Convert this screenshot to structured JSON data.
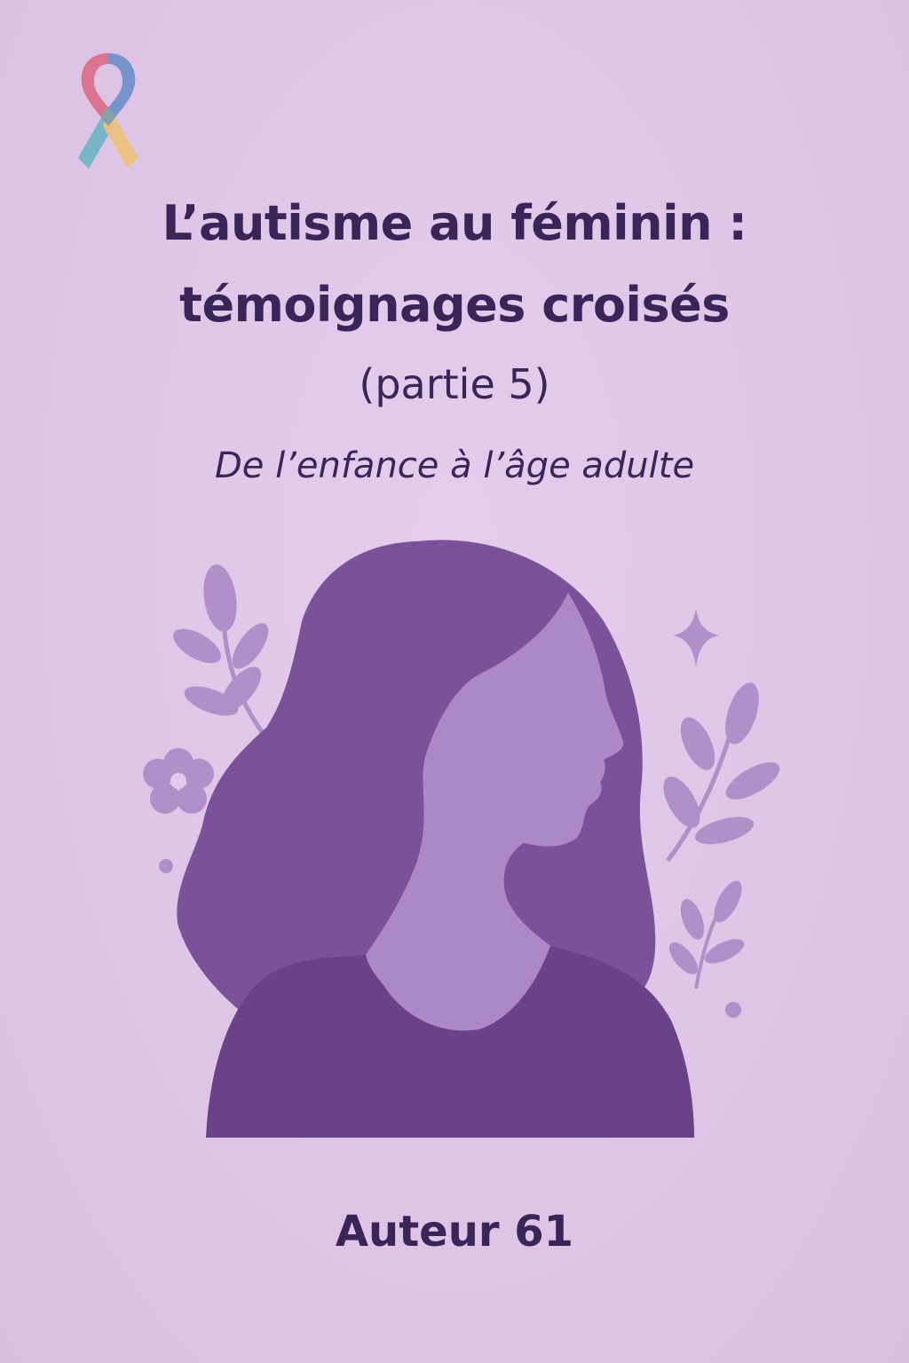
{
  "cover": {
    "title_line1": "L’autisme au féminin :",
    "title_line2": "témoignages croisés",
    "part": "(partie 5)",
    "subtitle": "De l’enfance à l’âge adulte",
    "author": "Auteur 61"
  },
  "colors": {
    "background": "#dec5e6",
    "text": "#3a2558",
    "hair": "#7b5299",
    "skin": "#ad88c6",
    "shirt": "#6b4289",
    "leaves": "#b28fc8"
  },
  "icons": {
    "ribbon": "awareness-ribbon-icon",
    "sparkle": "sparkle-icon",
    "flower": "flower-icon",
    "leaf_branch": "leaf-branch-icon"
  }
}
